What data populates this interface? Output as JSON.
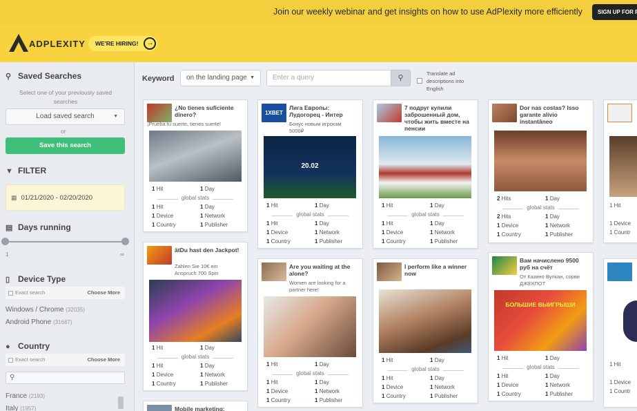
{
  "banner": {
    "text": "Join our weekly webinar and get insights on how to use AdPlexity more efficiently",
    "signup": "SIGN UP FOR FREE"
  },
  "header": {
    "logo": "ADPLEXITY",
    "hiring": "WE'RE HIRING!"
  },
  "sidebar": {
    "saved_searches": {
      "title": "Saved Searches",
      "hint": "Select one of your previously saved searches",
      "load": "Load saved search",
      "or": "or",
      "save": "Save this search"
    },
    "filter": {
      "title": "FILTER",
      "date_range": "01/21/2020 - 02/20/2020"
    },
    "days_running": {
      "title": "Days running",
      "min": "1",
      "max": "∞"
    },
    "device_type": {
      "title": "Device Type",
      "exact": "Exact search",
      "choose": "Choose More",
      "options": [
        {
          "label": "Windows / Chrome",
          "count": "(32035)"
        },
        {
          "label": "Android Phone",
          "count": "(31687)"
        }
      ]
    },
    "country": {
      "title": "Country",
      "exact": "Exact search",
      "choose": "Choose More",
      "options": [
        {
          "label": "France",
          "count": "(2193)"
        },
        {
          "label": "Italy",
          "count": "(1957)"
        }
      ]
    }
  },
  "search": {
    "label": "Keyword",
    "scope": "on the landing page",
    "placeholder": "Enter a query",
    "translate": "Translate ad descriptions into English"
  },
  "cards": [
    {
      "title": "¿No tienes suficiente dinero?",
      "desc": "¡Prueba tu suerte, tienes suerte!",
      "stats": {
        "hits": "1",
        "days": "1",
        "gs_hit": "1",
        "gs_day": "1",
        "device": "1",
        "network": "1",
        "country": "1",
        "publisher": "1"
      }
    },
    {
      "title": "ätDu hast den Jackpot!",
      "desc": "Zahlen Sie 10€ ein Anspruch 700 Spin",
      "stats": {
        "hits": "1",
        "days": "1",
        "gs_hit": "1",
        "gs_day": "1",
        "device": "1",
        "network": "1",
        "country": "1",
        "publisher": "1"
      }
    },
    {
      "title": "Лига Европы: Лудогорец - Интер",
      "desc": "Бонус новым игрокам 5000₽",
      "img_text": "20.02",
      "stats": {
        "hits": "1",
        "days": "1",
        "gs_hit": "1",
        "gs_day": "1",
        "device": "1",
        "network": "1",
        "country": "1",
        "publisher": "1"
      }
    },
    {
      "title": "Are you waiting at the alone?",
      "desc": "Women are looking for a partner here!",
      "stats": {
        "hits": "1",
        "days": "1",
        "gs_hit": "1",
        "gs_day": "1",
        "device": "1",
        "network": "1",
        "country": "1",
        "publisher": "1"
      }
    },
    {
      "title": "7 подруг купили заброшенный дом, чтобы жить вместе на пенсии",
      "desc": "",
      "stats": {
        "hits": "1",
        "days": "1",
        "gs_hit": "1",
        "gs_day": "1",
        "device": "1",
        "network": "1",
        "country": "1",
        "publisher": "1"
      }
    },
    {
      "title": "I perform like a winner now",
      "desc": "",
      "stats": {
        "hits": "1",
        "days": "1",
        "gs_hit": "1",
        "gs_day": "1",
        "device": "1",
        "network": "1",
        "country": "1",
        "publisher": "1"
      }
    },
    {
      "title": "Dor nas costas? Isso garante alívio instantâneo",
      "desc": "",
      "stats": {
        "hits": "2",
        "days": "1",
        "gs_hit": "2",
        "gs_day": "1",
        "device": "1",
        "network": "1",
        "country": "1",
        "publisher": "1"
      }
    },
    {
      "title": "Вам начислено 9500 руб на счёт",
      "desc": "От Казино Вулкан, сорви ДЖЕКПОТ",
      "img_text": "БОЛЬШИЕ ВЫИГРЫШИ",
      "stats": {
        "hits": "1",
        "days": "1",
        "gs_hit": "1",
        "gs_day": "1",
        "device": "1",
        "network": "1",
        "country": "1",
        "publisher": "1"
      }
    }
  ],
  "partial": {
    "mobile": "Mobile marketing:",
    "hit": "1 Hit",
    "device": "1 Device",
    "country": "1 Countr",
    "hits_label": "Hit",
    "days_label": "Day",
    "global": "global stats",
    "device_label": "Device",
    "network_label": "Network",
    "country_label": "Country",
    "publisher_label": "Publisher"
  }
}
